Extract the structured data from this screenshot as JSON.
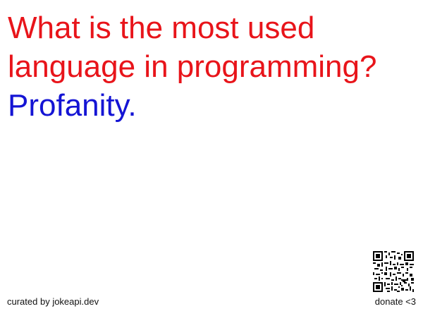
{
  "joke": {
    "setup": "What is the most used language in programming?",
    "punchline": "Profanity."
  },
  "footer": {
    "credit": "curated by jokeapi.dev",
    "donate": "donate <3"
  },
  "colors": {
    "setup": "#e8141a",
    "punchline": "#1414d4",
    "background": "#ffffff"
  }
}
